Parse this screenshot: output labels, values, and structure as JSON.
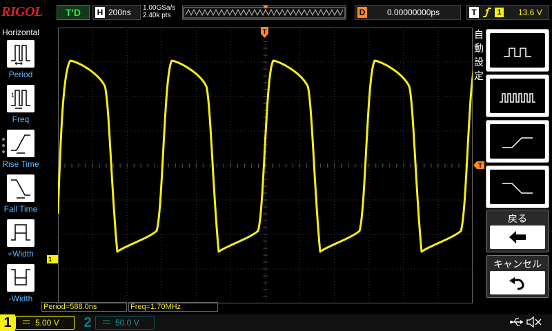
{
  "top": {
    "logo": "RIGOL",
    "status": "T'D",
    "horizontal": {
      "letter": "H",
      "scale": "200ns",
      "sample_rate": "1.00GSa/s",
      "memory_depth": "2.40k pts"
    },
    "delay": {
      "letter": "D",
      "value": "0.00000000ps"
    },
    "trigger": {
      "letter": "T",
      "edge": "rising-edge-icon",
      "source": "1",
      "level": "13.6 V"
    },
    "trigger_marker": "T"
  },
  "left_menu": {
    "title": "Horizontal",
    "items": [
      {
        "label": "Period",
        "icon": "period-measure-icon"
      },
      {
        "label": "Freq",
        "icon": "frequency-measure-icon"
      },
      {
        "label": "Rise Time",
        "icon": "rise-time-icon"
      },
      {
        "label": "Fall Time",
        "icon": "fall-time-icon"
      },
      {
        "label": "+Width",
        "icon": "positive-width-icon"
      },
      {
        "label": "-Width",
        "icon": "negative-width-icon"
      }
    ]
  },
  "right_menu": {
    "title": "自動設定",
    "buttons": [
      {
        "icon": "single-pulse-icon"
      },
      {
        "icon": "pulse-train-icon"
      },
      {
        "icon": "rising-edge-icon"
      },
      {
        "icon": "falling-edge-icon"
      }
    ],
    "back": {
      "label": "戻る",
      "icon": "back-arrow-icon"
    },
    "cancel": {
      "label": "キャンセル",
      "icon": "undo-icon"
    }
  },
  "measurements": {
    "period": "Period=588.0ns",
    "freq": "Freq=1.70MHz"
  },
  "channels": {
    "ch1": {
      "number": "1",
      "scale": "5.00 V",
      "marker": "1",
      "color": "#f5ef16"
    },
    "ch2": {
      "number": "2",
      "scale": "50.0 V",
      "color": "#0a7c82"
    }
  },
  "status_icons": [
    "usb-icon",
    "speaker-muted-icon"
  ],
  "waveform": {
    "shape": "square",
    "color": "#f5ef16",
    "cycles_visible": 4
  }
}
